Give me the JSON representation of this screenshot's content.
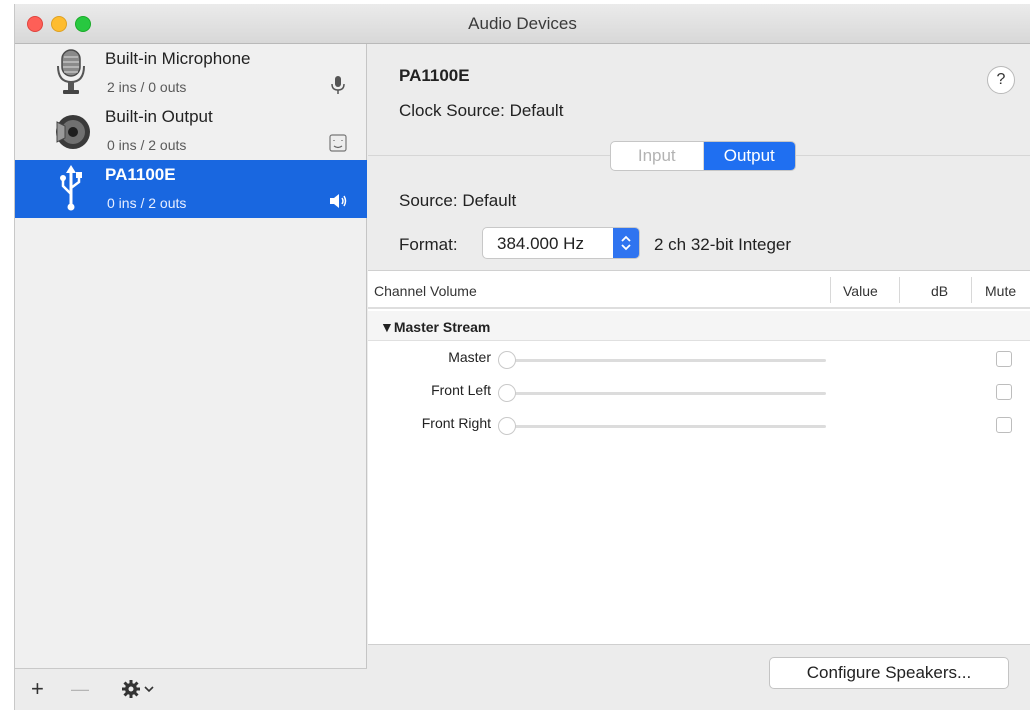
{
  "window": {
    "title": "Audio Devices"
  },
  "sidebar": {
    "devices": [
      {
        "name": "Built-in Microphone",
        "io": "2 ins / 0 outs",
        "icon": "microphone-icon",
        "status_icon": "mic-indicator-icon"
      },
      {
        "name": "Built-in Output",
        "io": "0 ins / 2 outs",
        "icon": "speaker-icon",
        "status_icon": "finder-icon"
      },
      {
        "name": "PA1100E",
        "io": "0 ins / 2 outs",
        "icon": "usb-icon",
        "status_icon": "volume-icon",
        "selected": true
      }
    ],
    "footer": {
      "add": "+",
      "remove": "—",
      "gear": "gear-icon"
    }
  },
  "detail": {
    "device_name": "PA1100E",
    "clock_label": "Clock Source:",
    "clock_value": "Default",
    "help": "?",
    "tabs": {
      "input": "Input",
      "output": "Output",
      "selected": "Output"
    },
    "source_label": "Source:",
    "source_value": "Default",
    "format_label": "Format:",
    "format_rate": "384.000 Hz",
    "format_desc": "2 ch 32-bit Integer",
    "table": {
      "headers": {
        "channel": "Channel Volume",
        "value": "Value",
        "db": "dB",
        "mute": "Mute"
      },
      "group": "▼Master Stream",
      "channels": [
        {
          "label": "Master",
          "volume": 0,
          "muted": false
        },
        {
          "label": "Front Left",
          "volume": 0,
          "muted": false
        },
        {
          "label": "Front Right",
          "volume": 0,
          "muted": false
        }
      ]
    },
    "configure_button": "Configure Speakers..."
  },
  "colors": {
    "accent": "#1967e0",
    "segment_selected": "#1f6ff1"
  }
}
